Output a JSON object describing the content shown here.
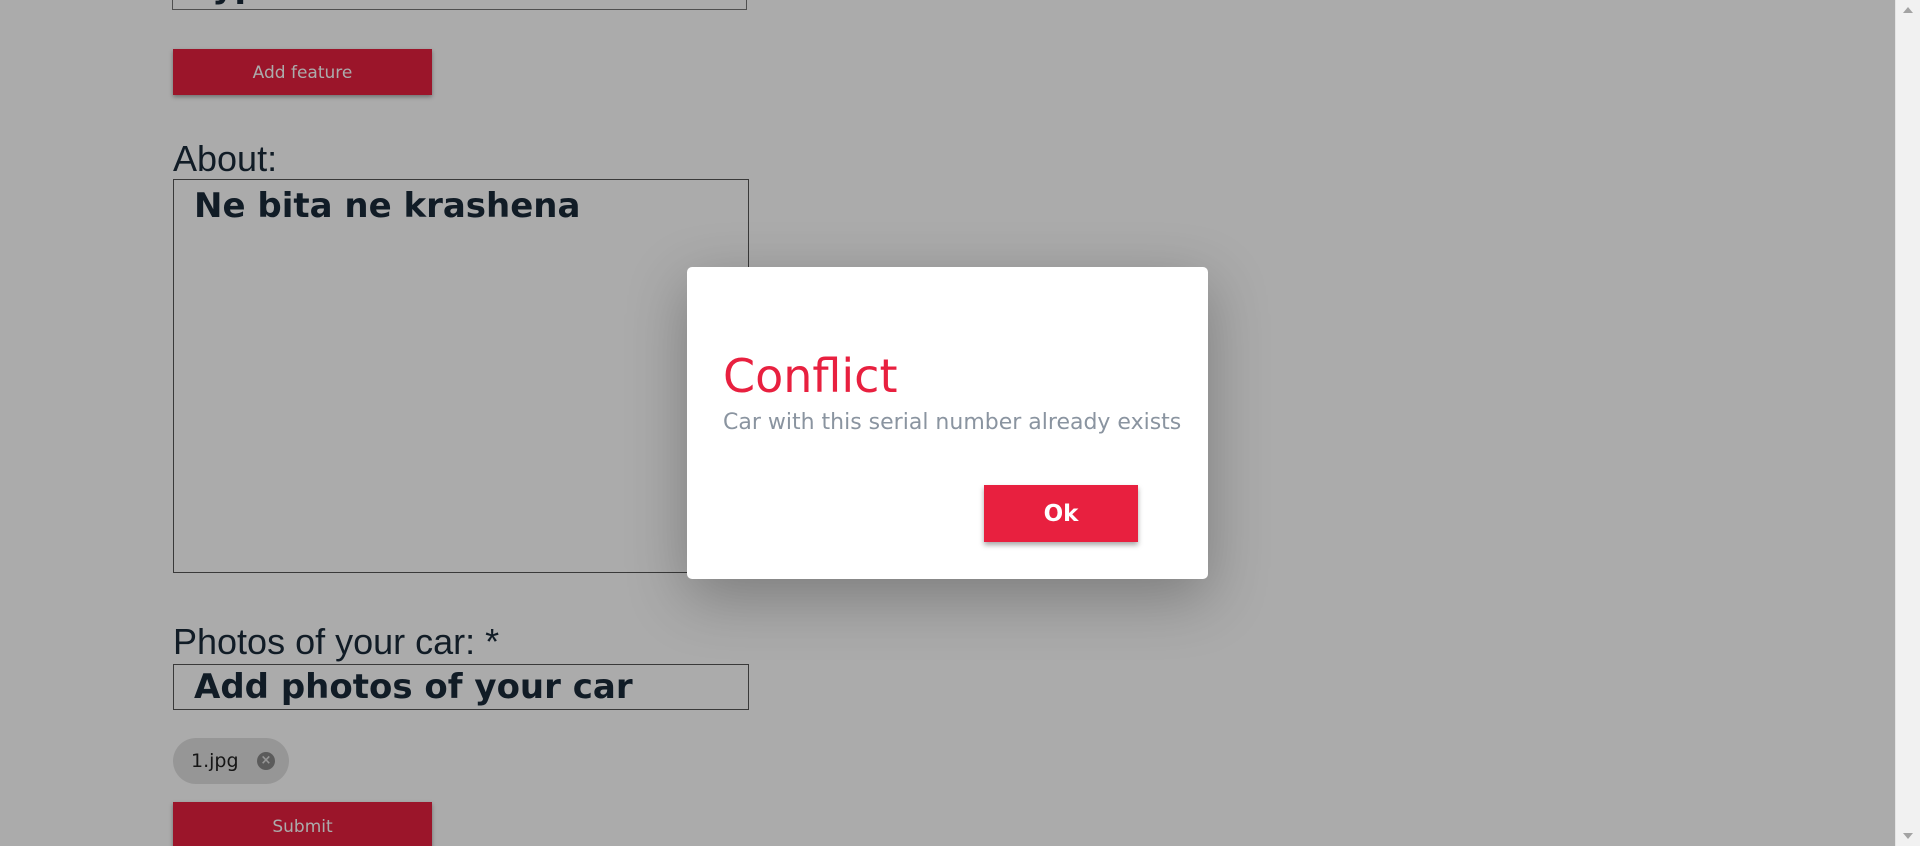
{
  "form": {
    "previous_input_value": "Typ",
    "add_feature_label": "Add feature",
    "about_label": "About:",
    "about_value": "Ne bita ne krashena",
    "photos_label": "Photos of your car: *",
    "photos_placeholder": "Add photos of your car",
    "files": [
      {
        "name": "1.jpg"
      }
    ],
    "submit_label": "Submit"
  },
  "dialog": {
    "title": "Conflict",
    "message": "Car with this serial number already exists",
    "ok_label": "Ok"
  },
  "colors": {
    "accent": "#e8203f",
    "overlay": "#000000",
    "dialog_message": "#8a94a0"
  },
  "icons": {
    "chip_remove": "close-circle-icon",
    "scroll_up": "chevron-up-icon",
    "scroll_down": "chevron-down-icon"
  }
}
